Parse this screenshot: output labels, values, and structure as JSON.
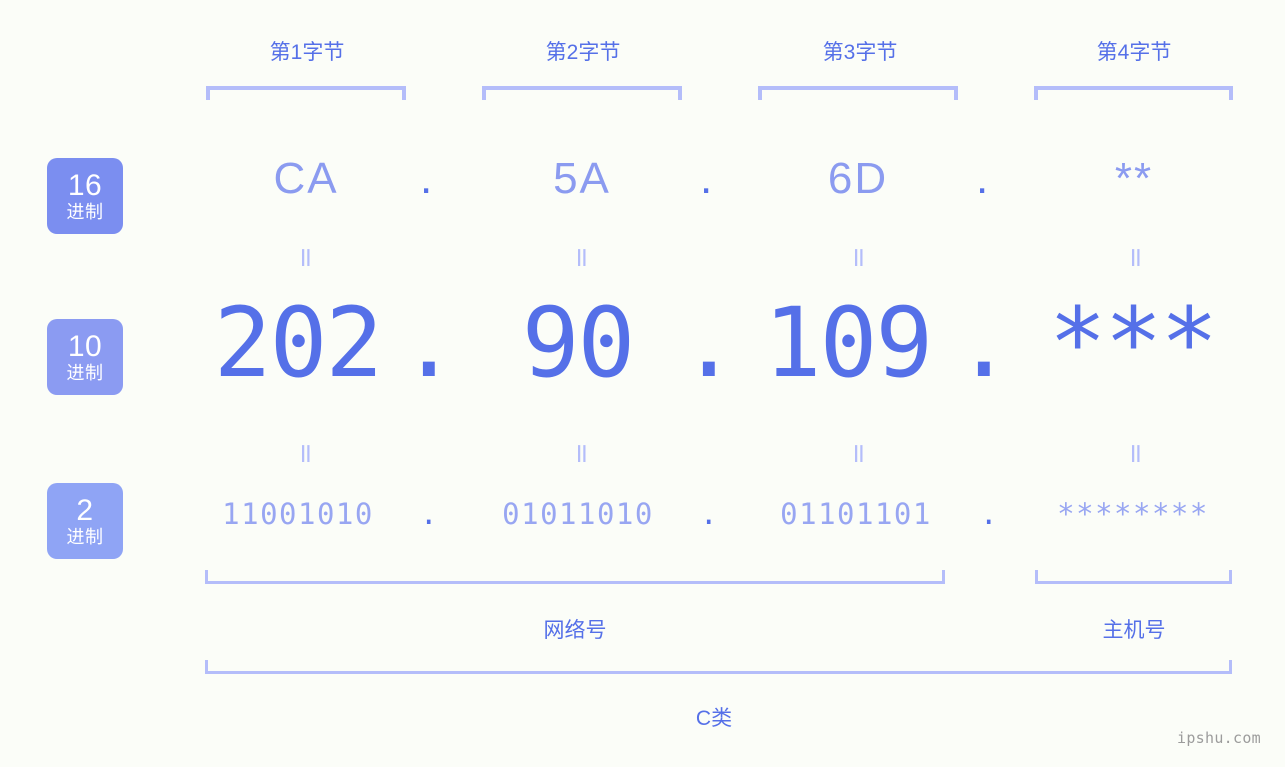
{
  "meta": {
    "background_color": "#fbfdf8",
    "accent_color": "#5570e8",
    "accent_light_color": "#8b9bf0",
    "bracket_color": "#b4bdfa"
  },
  "byte_headers": [
    {
      "label": "第1字节"
    },
    {
      "label": "第2字节"
    },
    {
      "label": "第3字节"
    },
    {
      "label": "第4字节"
    }
  ],
  "rows": [
    {
      "badge": {
        "number": "16",
        "unit": "进制",
        "color": "#7b8ef0"
      },
      "name": "hexadecimal",
      "octets": [
        "CA",
        "5A",
        "6D",
        "**"
      ],
      "separator": "."
    },
    {
      "badge": {
        "number": "10",
        "unit": "进制",
        "color": "#8b9bf2"
      },
      "name": "decimal",
      "octets": [
        "202",
        "90",
        "109",
        "***"
      ],
      "separator": "."
    },
    {
      "badge": {
        "number": "2",
        "unit": "进制",
        "color": "#8fa4f5"
      },
      "name": "binary",
      "octets": [
        "11001010",
        "01011010",
        "01101101",
        "********"
      ],
      "separator": "."
    }
  ],
  "connectors": {
    "symbol": "="
  },
  "sections": [
    {
      "label": "网络号"
    },
    {
      "label": "主机号"
    }
  ],
  "ip_class": {
    "label": "C类"
  },
  "watermark": {
    "text": "ipshu.com"
  }
}
